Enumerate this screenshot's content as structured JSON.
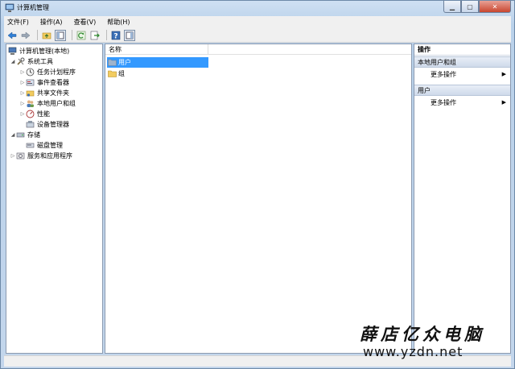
{
  "window": {
    "title": "计算机管理",
    "icon": "computer-management-icon"
  },
  "menu": [
    {
      "label": "文件(F)"
    },
    {
      "label": "操作(A)"
    },
    {
      "label": "查看(V)"
    },
    {
      "label": "帮助(H)"
    }
  ],
  "toolbar": {
    "icons": [
      "back-arrow-icon",
      "forward-arrow-icon",
      "up-folder-icon",
      "show-hide-tree-icon",
      "refresh-icon",
      "export-list-icon",
      "help-icon",
      "show-hide-action-pane-icon"
    ]
  },
  "tree": {
    "root": "计算机管理(本地)",
    "items": [
      {
        "label": "系统工具"
      },
      {
        "label": "任务计划程序"
      },
      {
        "label": "事件查看器"
      },
      {
        "label": "共享文件夹"
      },
      {
        "label": "本地用户和组"
      },
      {
        "label": "性能"
      },
      {
        "label": "设备管理器"
      },
      {
        "label": "存储"
      },
      {
        "label": "磁盘管理"
      },
      {
        "label": "服务和应用程序"
      }
    ]
  },
  "list": {
    "column_name": "名称",
    "rows": [
      {
        "label": "用户",
        "selected": true
      },
      {
        "label": "组",
        "selected": false
      }
    ]
  },
  "actions": {
    "title": "操作",
    "groups": [
      {
        "label": "本地用户和组",
        "item": "更多操作"
      },
      {
        "label": "用户",
        "item": "更多操作"
      }
    ]
  },
  "watermark": {
    "line1": "薛店亿众电脑",
    "line2": "www.yzdn.net"
  },
  "colors": {
    "selection": "#3399ff",
    "frame": "#b9d1ea"
  }
}
